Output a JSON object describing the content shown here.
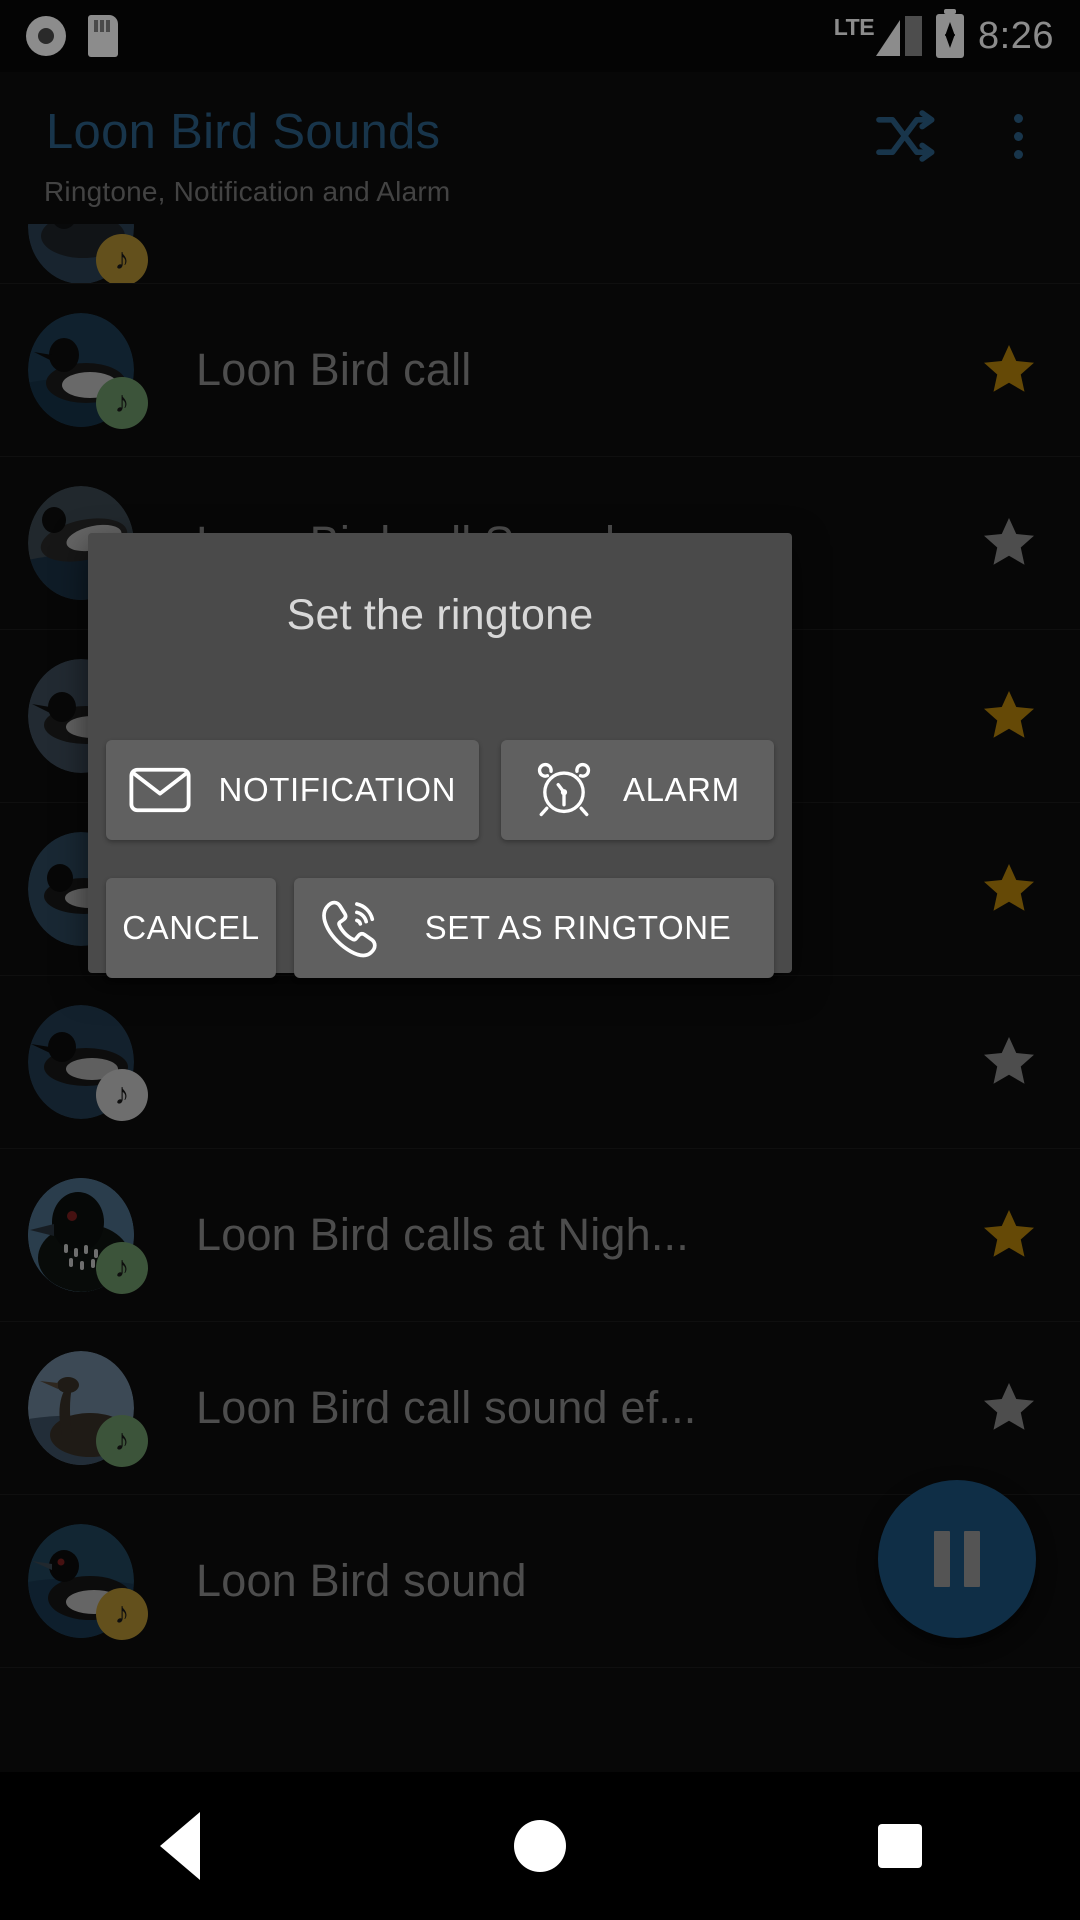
{
  "status_bar": {
    "record_icon": "record-icon",
    "sd_card_icon": "sd-card-icon",
    "network_label": "LTE",
    "signal_icon": "signal-bars-icon",
    "battery_icon": "battery-charging-icon",
    "time": "8:26"
  },
  "app_bar": {
    "title": "Loon Bird Sounds",
    "subtitle": "Ringtone, Notification and Alarm",
    "shuffle_icon": "shuffle-icon",
    "overflow_icon": "more-vert-icon",
    "accent_color": "#2d6289"
  },
  "list": {
    "items": [
      {
        "title": "",
        "note_color": "amber",
        "starred": null,
        "partial": true,
        "thumb": "loon-a"
      },
      {
        "title": "Loon Bird call",
        "note_color": "green",
        "starred": true,
        "partial": false,
        "thumb": "loon-b"
      },
      {
        "title": "Loon Bird call Sound",
        "note_color": "grey",
        "starred": false,
        "partial": false,
        "thumb": "loon-c"
      },
      {
        "title": "",
        "note_color": "grey",
        "starred": true,
        "partial": false,
        "thumb": "loon-d"
      },
      {
        "title": "",
        "note_color": "grey",
        "starred": true,
        "partial": false,
        "thumb": "loon-e"
      },
      {
        "title": "",
        "note_color": "grey",
        "starred": false,
        "partial": false,
        "thumb": "loon-f"
      },
      {
        "title": "Loon Bird calls at Nigh...",
        "note_color": "green",
        "starred": true,
        "partial": false,
        "thumb": "loon-g"
      },
      {
        "title": "Loon Bird call sound ef...",
        "note_color": "green",
        "starred": false,
        "partial": false,
        "thumb": "loon-h"
      },
      {
        "title": "Loon Bird sound",
        "note_color": "amber",
        "starred": null,
        "partial": false,
        "thumb": "loon-i"
      }
    ],
    "star_filled_color": "#b8860b",
    "star_empty_color": "#8c8c8c"
  },
  "dialog": {
    "title": "Set the ringtone",
    "notification_label": "NOTIFICATION",
    "notification_icon": "envelope-icon",
    "alarm_label": "ALARM",
    "alarm_icon": "alarm-clock-icon",
    "cancel_label": "CANCEL",
    "ringtone_label": "SET AS RINGTONE",
    "ringtone_icon": "phone-ringing-icon"
  },
  "fab": {
    "icon": "pause-icon",
    "color": "#1c5480"
  },
  "nav_bar": {
    "back_label": "back-icon",
    "home_label": "home-icon",
    "recents_label": "recents-icon"
  }
}
